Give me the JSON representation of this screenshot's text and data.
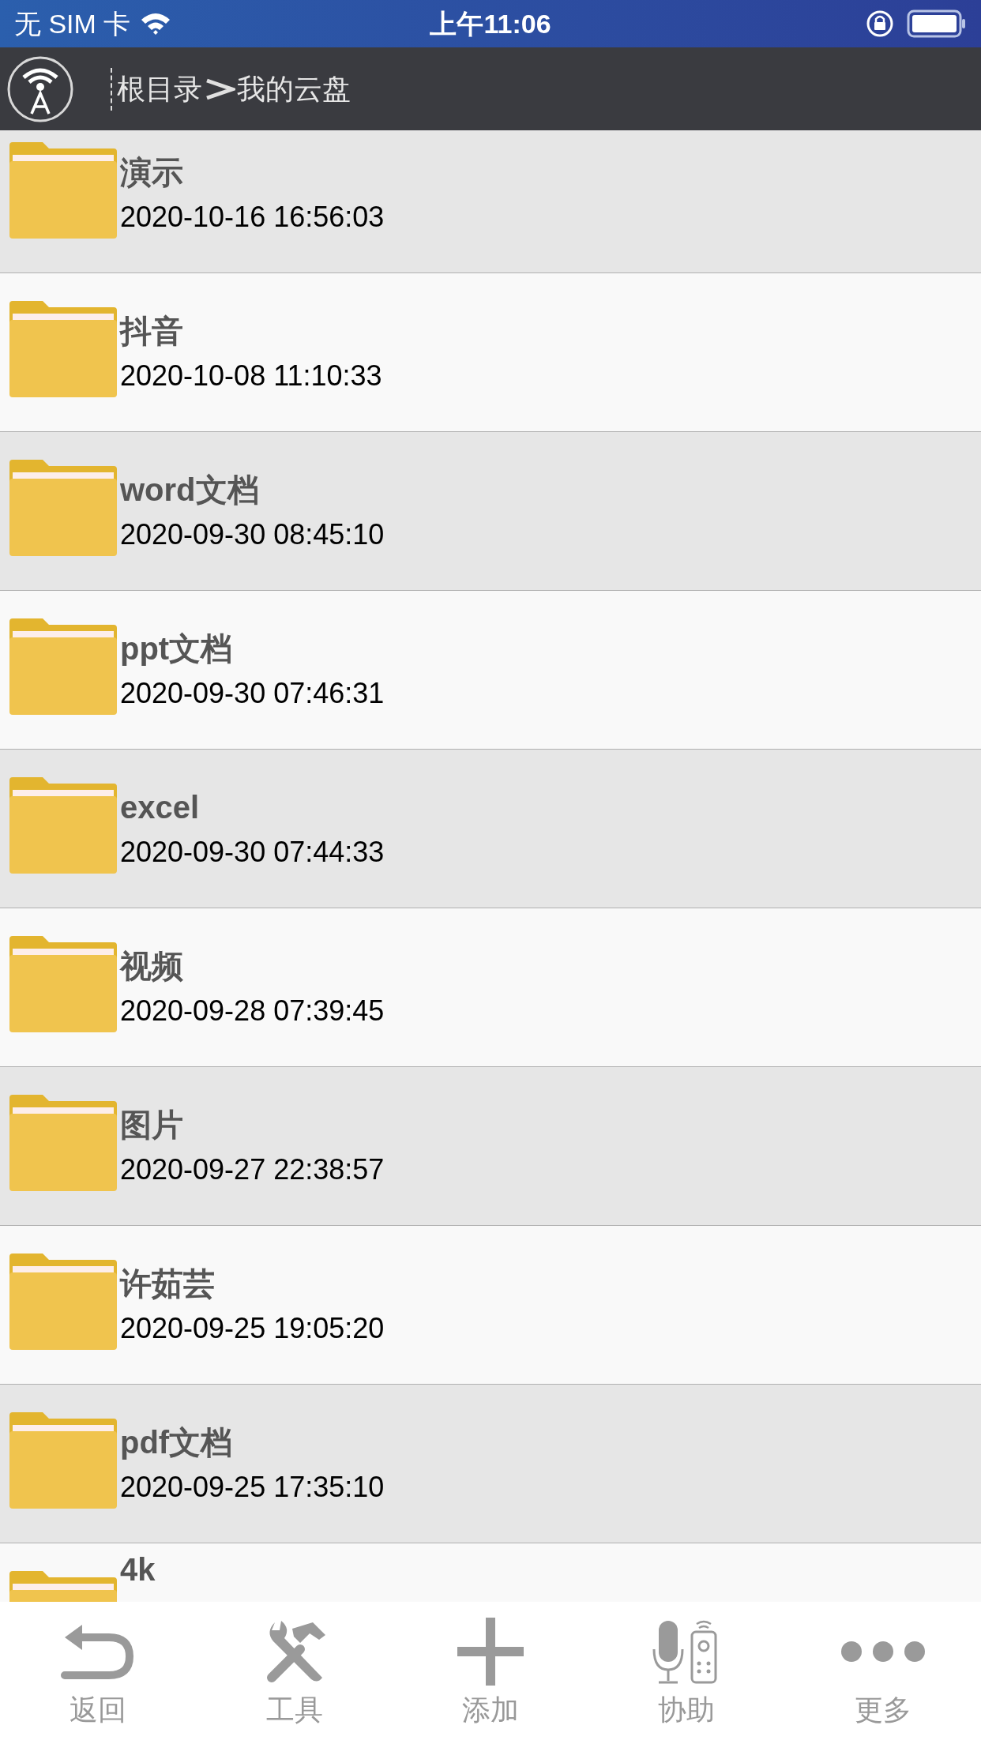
{
  "status_bar": {
    "carrier": "无 SIM 卡",
    "time": "上午11:06"
  },
  "header": {
    "breadcrumb": [
      {
        "label": "根目录"
      },
      {
        "label": "我的云盘"
      }
    ]
  },
  "files": [
    {
      "name": "演示",
      "date": "2020-10-16 16:56:03"
    },
    {
      "name": "抖音",
      "date": "2020-10-08 11:10:33"
    },
    {
      "name": "word文档",
      "date": "2020-09-30 08:45:10"
    },
    {
      "name": "ppt文档",
      "date": "2020-09-30 07:46:31"
    },
    {
      "name": "excel",
      "date": "2020-09-30 07:44:33"
    },
    {
      "name": "视频",
      "date": "2020-09-28 07:39:45"
    },
    {
      "name": "图片",
      "date": "2020-09-27 22:38:57"
    },
    {
      "name": "许茹芸",
      "date": "2020-09-25 19:05:20"
    },
    {
      "name": "pdf文档",
      "date": "2020-09-25 17:35:10"
    },
    {
      "name": "4k"
    }
  ],
  "toolbar": [
    {
      "kind": "back",
      "label": "返回"
    },
    {
      "kind": "tools",
      "label": "工具"
    },
    {
      "kind": "add",
      "label": "添加"
    },
    {
      "kind": "assist",
      "label": "协助"
    },
    {
      "kind": "more",
      "label": "更多"
    }
  ]
}
